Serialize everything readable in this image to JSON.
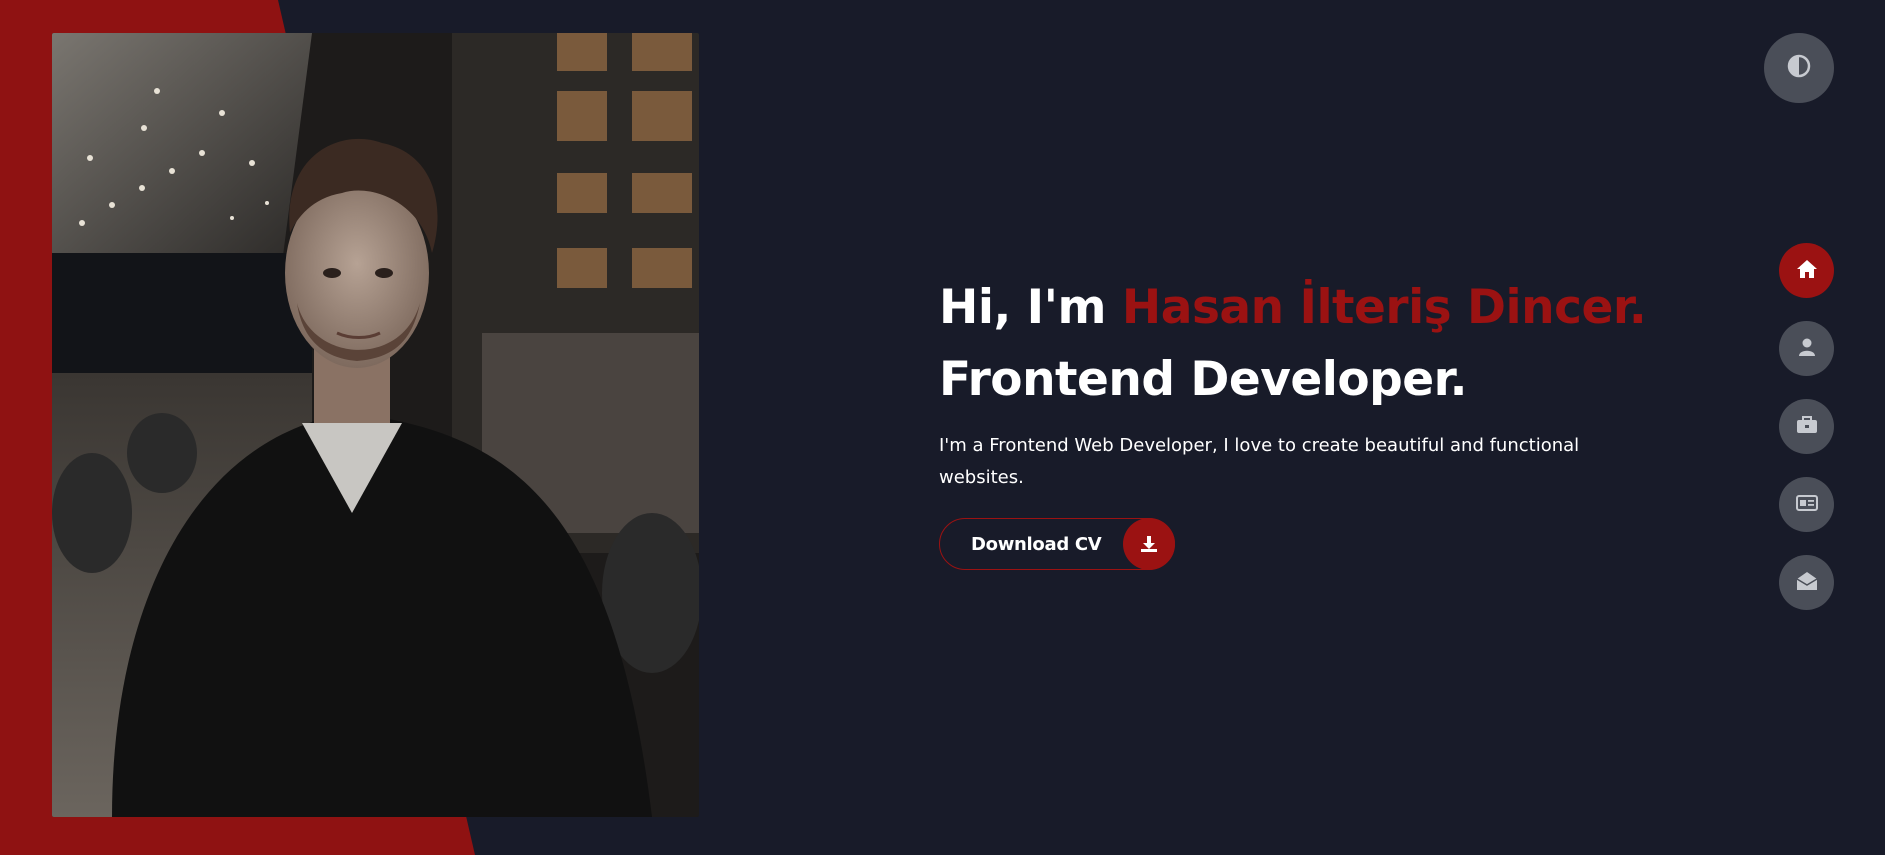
{
  "hero": {
    "greeting": "Hi, I'm ",
    "name": "Hasan İlteriş Dincer.",
    "role": "Frontend Developer.",
    "intro": "I'm a Frontend Web Developer, I love to create beautiful and functional websites.",
    "download_label": "Download CV"
  },
  "icons": {
    "theme_toggle": "contrast-icon",
    "download": "download-icon"
  },
  "nav": {
    "items": [
      {
        "id": "home",
        "icon": "home-icon",
        "active": true
      },
      {
        "id": "about",
        "icon": "user-icon",
        "active": false
      },
      {
        "id": "portfolio",
        "icon": "briefcase-icon",
        "active": false
      },
      {
        "id": "resume",
        "icon": "id-card-icon",
        "active": false
      },
      {
        "id": "contact",
        "icon": "envelope-open-icon",
        "active": false
      }
    ]
  },
  "colors": {
    "background": "#181b29",
    "accent": "#9b1212",
    "nav_button": "#4a4e58",
    "text": "#ffffff"
  }
}
